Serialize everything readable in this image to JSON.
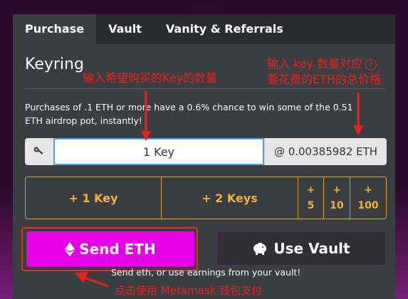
{
  "tabs": [
    {
      "label": "Purchase",
      "active": true
    },
    {
      "label": "Vault",
      "active": false
    },
    {
      "label": "Vanity & Referrals",
      "active": false
    }
  ],
  "keyring": {
    "title": "Keyring",
    "description": "Purchases of .1 ETH or more have a 0.6% chance to win some of the 0.51 ETH airdrop pot, instantly!",
    "key_input_value": "1 Key",
    "price": "@ 0.00385982 ETH"
  },
  "quantity_buttons": [
    {
      "label": "+ 1 Key"
    },
    {
      "label": "+ 2 Keys"
    },
    {
      "plus": "+",
      "amount": "5"
    },
    {
      "plus": "+",
      "amount": "10"
    },
    {
      "plus": "+",
      "amount": "100"
    }
  ],
  "actions": {
    "send_label": "Send ETH",
    "vault_label": "Use Vault",
    "hint": "Send eth, or use earnings from your vault!"
  },
  "annotations": {
    "input_note": "输入希望购买的Key的数量",
    "price_note_line1": "输入 key 数量对应",
    "price_note_line2": "要花费的ETH的总价格",
    "help_glyph": "?",
    "send_note": "点击使用 Metamask 钱包支付"
  },
  "colors": {
    "accent_orange": "#f4b23a",
    "send_magenta": "#e600e6",
    "annotation_red": "#e8231a",
    "input_border_blue": "#4aa3e0"
  }
}
